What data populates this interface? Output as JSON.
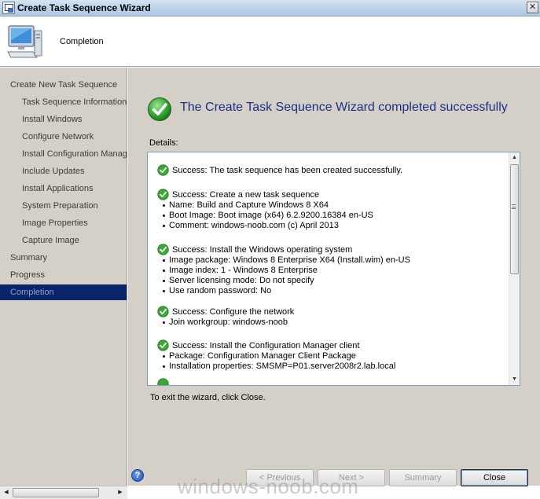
{
  "window": {
    "title": "Create Task Sequence Wizard",
    "close_glyph": "✕"
  },
  "header": {
    "page_heading": "Completion"
  },
  "nav": {
    "items": [
      {
        "label": "Create New Task Sequence",
        "level": 1
      },
      {
        "label": "Task Sequence Information",
        "level": 2
      },
      {
        "label": "Install Windows",
        "level": 2
      },
      {
        "label": "Configure Network",
        "level": 2
      },
      {
        "label": "Install Configuration Manag",
        "level": 2
      },
      {
        "label": "Include Updates",
        "level": 2
      },
      {
        "label": "Install Applications",
        "level": 2
      },
      {
        "label": "System Preparation",
        "level": 2
      },
      {
        "label": "Image Properties",
        "level": 2
      },
      {
        "label": "Capture Image",
        "level": 2
      },
      {
        "label": "Summary",
        "level": 1
      },
      {
        "label": "Progress",
        "level": 1
      },
      {
        "label": "Completion",
        "level": 1,
        "active": true
      }
    ]
  },
  "main": {
    "heading": "The Create Task Sequence Wizard completed successfully",
    "details_label": "Details:",
    "details": [
      {
        "head": "Success: The task sequence has been created successfully.",
        "items": []
      },
      {
        "head": "Success: Create a new task sequence",
        "items": [
          "Name: Build and Capture Windows 8 X64",
          "Boot Image: Boot image (x64) 6.2.9200.16384 en-US",
          "Comment: windows-noob.com (c) April 2013"
        ]
      },
      {
        "head": "Success: Install the Windows operating system",
        "items": [
          "Image package: Windows 8 Enterprise X64 (Install.wim) en-US",
          "Image index: 1 - Windows 8 Enterprise",
          "Server licensing mode: Do not specify",
          "Use random password: No"
        ]
      },
      {
        "head": "Success: Configure the network",
        "items": [
          "Join workgroup: windows-noob"
        ]
      },
      {
        "head": "Success: Install the Configuration Manager client",
        "items": [
          "Package: Configuration Manager Client Package",
          "Installation properties: SMSMP=P01.server2008r2.lab.local"
        ]
      }
    ],
    "exit_text": "To exit the wizard, click Close."
  },
  "buttons": {
    "previous": "< Previous",
    "next": "Next >",
    "summary": "Summary",
    "close": "Close",
    "help": "?"
  },
  "watermark": "windows-noob.com",
  "colors": {
    "heading": "#1c2f8a",
    "nav_active_bg": "#0a246a",
    "success_green": "#2e9b2e"
  }
}
